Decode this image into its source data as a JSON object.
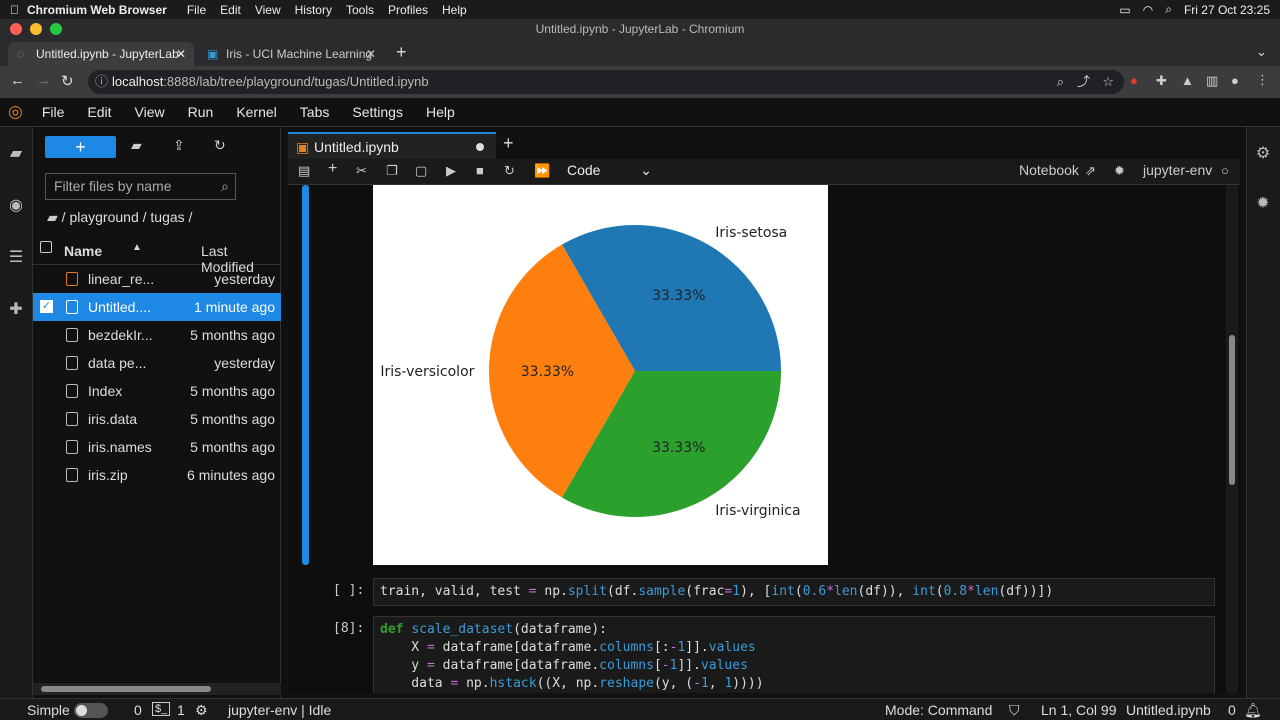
{
  "macbar": {
    "app": "Chromium Web Browser",
    "menus": [
      "File",
      "Edit",
      "View",
      "History",
      "Tools",
      "Profiles",
      "Help"
    ],
    "clock": "Fri 27 Oct 23:25"
  },
  "window": {
    "title": "Untitled.ipynb - JupyterLab - Chromium"
  },
  "browser_tabs": [
    {
      "label": "Untitled.ipynb - JupyterLab"
    },
    {
      "label": "Iris - UCI Machine Learning"
    }
  ],
  "address": {
    "host": "localhost",
    "rest": ":8888/lab/tree/playground/tugas/Untitled.ipynb"
  },
  "jupyter_menu": [
    "File",
    "Edit",
    "View",
    "Run",
    "Kernel",
    "Tabs",
    "Settings",
    "Help"
  ],
  "filebrowser": {
    "new_label": "+",
    "filter_placeholder": "Filter files by name",
    "breadcrumb": "/ playground / tugas /",
    "col_name": "Name",
    "col_modified": "Last Modified",
    "files": [
      {
        "name": "linear_re...",
        "modified": "yesterday",
        "type": "notebook"
      },
      {
        "name": "Untitled....",
        "modified": "1 minute ago",
        "type": "notebook",
        "selected": true
      },
      {
        "name": "bezdekIr...",
        "modified": "5 months ago",
        "type": "file"
      },
      {
        "name": "data pe...",
        "modified": "yesterday",
        "type": "file"
      },
      {
        "name": "Index",
        "modified": "5 months ago",
        "type": "file"
      },
      {
        "name": "iris.data",
        "modified": "5 months ago",
        "type": "file"
      },
      {
        "name": "iris.names",
        "modified": "5 months ago",
        "type": "file"
      },
      {
        "name": "iris.zip",
        "modified": "6 minutes ago",
        "type": "file"
      }
    ]
  },
  "notebook": {
    "tab_label": "Untitled.ipynb",
    "cell_type": "Code",
    "notebook_label": "Notebook",
    "kernel": "jupyter-env",
    "cells": [
      {
        "prompt": "[ ]:"
      },
      {
        "prompt": "[8]:"
      }
    ]
  },
  "chart_data": {
    "type": "pie",
    "categories": [
      "Iris-setosa",
      "Iris-versicolor",
      "Iris-virginica"
    ],
    "values": [
      33.33,
      33.33,
      33.33
    ],
    "pct_labels": [
      "33.33%",
      "33.33%",
      "33.33%"
    ],
    "colors": [
      "#1f77b4",
      "#ff7f0e",
      "#2ca02c"
    ]
  },
  "status": {
    "mode_label": "Simple",
    "zero": "0",
    "one": "1",
    "kernel_state": "jupyter-env | Idle",
    "mode": "Mode: Command",
    "position": "Ln 1, Col 99",
    "file": "Untitled.ipynb",
    "bell": "0"
  }
}
